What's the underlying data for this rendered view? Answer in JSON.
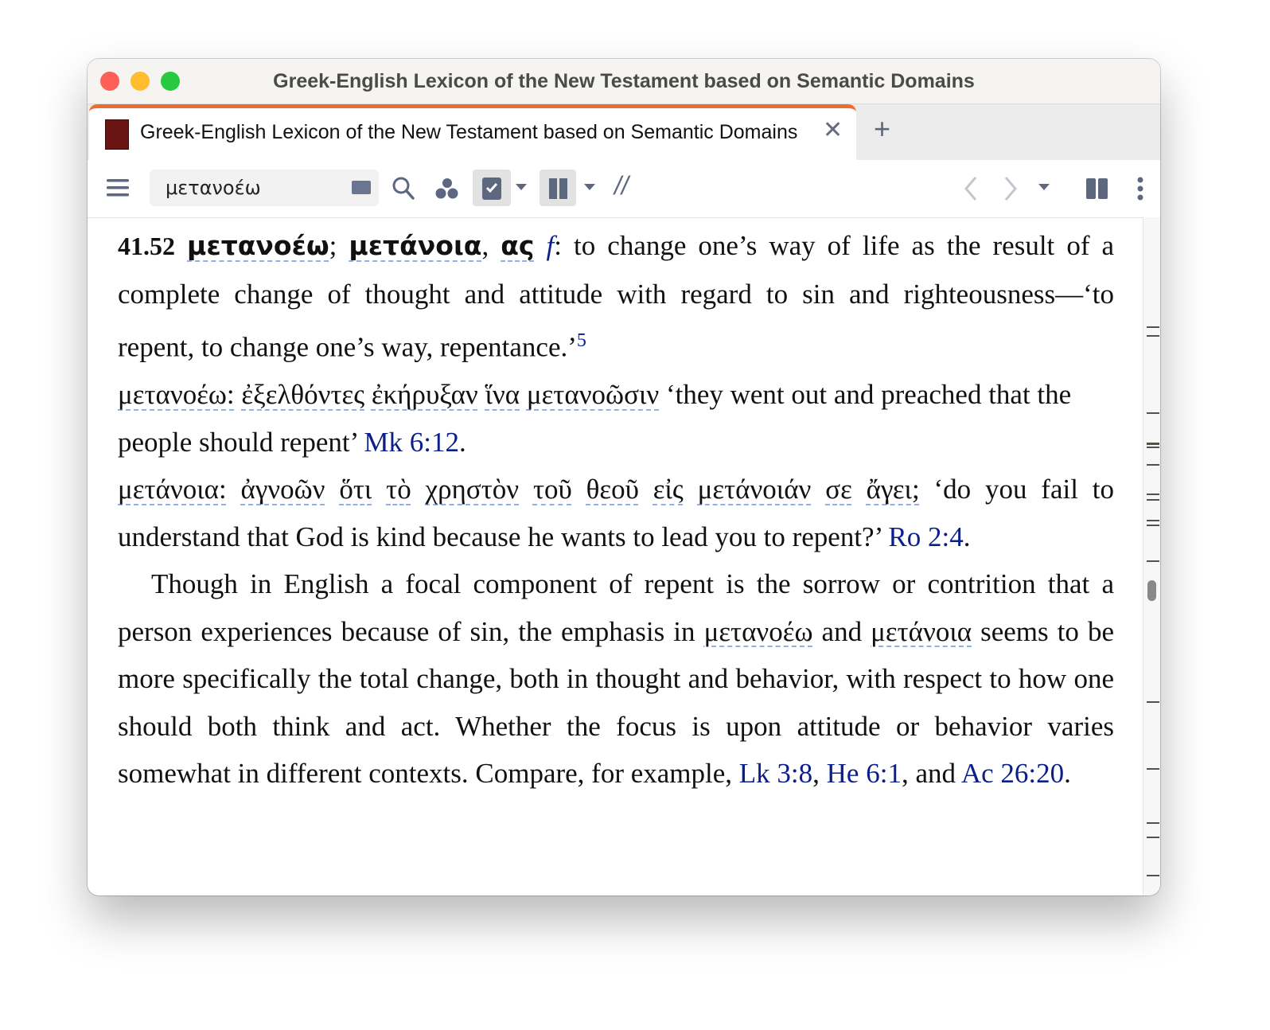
{
  "window": {
    "title": "Greek-English Lexicon of the New Testament based on Semantic Domains"
  },
  "tab": {
    "label": "Greek-English Lexicon of the New Testament based on Semantic Domains",
    "close": "✕",
    "new": "+"
  },
  "toolbar": {
    "search_value": "μετανοέω",
    "parallel": "//"
  },
  "entry": {
    "number": "41.52",
    "headword1": "μετανοέω",
    "sep1": "; ",
    "headword2": "μετάνοια",
    "sep2": ", ",
    "ending": "ας",
    "gender": "f",
    "definition": ": to change one’s way of life as the result of a complete change of thought and attitude with regard to sin and righteousness—‘to repent, to change one’s way, repentance.’",
    "footnote": "5",
    "ex1_label": "μετανοέω:",
    "ex1_greek": [
      "ἐξελθόντες",
      "ἐκήρυξαν",
      "ἵνα",
      "μετανοῶσιν"
    ],
    "ex1_english": " ‘they went out and preached that the people should repent’ ",
    "ex1_ref": "Mk 6:12",
    "ex2_label": "μετάνοια:",
    "ex2_greek": [
      "ἀγνοῶν",
      "ὅτι",
      "τὸ",
      "χρηστὸν",
      "τοῦ",
      "θεοῦ",
      "εἰς",
      "μετάνοιάν",
      "σε",
      "ἄγει;"
    ],
    "ex2_english": " ‘do you fail to understand that God is kind because he wants to lead you to repent?’ ",
    "ex2_ref": "Ro 2:4",
    "para_a": "Though in English a focal component of repent is the sorrow or contrition that a person experiences because of sin, the emphasis in ",
    "para_gk1": "μετανοέω",
    "para_b": " and ",
    "para_gk2": "μετάνοια",
    "para_c": " seems to be more specifically the total change, both in thought and behavior, with respect to how one should both think and act. Whether the focus is upon attitude or behavior varies somewhat in different contexts. Compare, for example, ",
    "ref1": "Lk 3:8",
    "ref_sep": ", ",
    "ref2": "He 6:1",
    "ref_and": ", and ",
    "ref3": "Ac 26:20",
    "period": "."
  },
  "colors": {
    "accent": "#ef6c2c",
    "link": "#0b1f8a",
    "icon": "#5d6780"
  }
}
